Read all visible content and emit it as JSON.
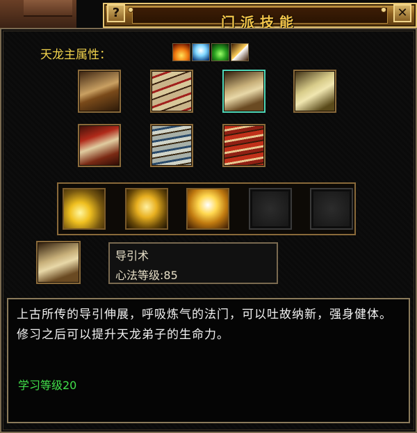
{
  "window": {
    "title": "门派技能",
    "help_label": "?",
    "close_label": "✕"
  },
  "attributes": {
    "label": "天龙主属性：",
    "icons": [
      "fire-attribute-icon",
      "ice-attribute-icon",
      "poison-attribute-icon",
      "lightning-attribute-icon"
    ]
  },
  "skill_books": [
    {
      "name": "scroll-book-icon",
      "selected": false
    },
    {
      "name": "bundled-scrolls-icon",
      "selected": false
    },
    {
      "name": "open-book-icon",
      "selected": true
    },
    {
      "name": "ancient-tome-icon",
      "selected": false
    },
    {
      "name": "figure-manual-icon",
      "selected": false
    },
    {
      "name": "blue-book-stack-icon",
      "selected": false
    },
    {
      "name": "red-book-stack-icon",
      "selected": false
    }
  ],
  "skills": [
    {
      "name": "scroll-glow-skill-icon",
      "empty": false
    },
    {
      "name": "golden-figure-skill-icon",
      "empty": false
    },
    {
      "name": "radiant-hands-skill-icon",
      "empty": false
    },
    {
      "name": "empty-skill-slot",
      "empty": true
    },
    {
      "name": "empty-skill-slot",
      "empty": true
    }
  ],
  "selected_skill": {
    "name": "导引术",
    "level": "心法等级:85"
  },
  "description": {
    "text": "上古所传的导引伸展，呼吸炼气的法门，可以吐故纳新，强身健体。修习之后可以提升天龙弟子的生命力。",
    "learn_level": "学习等级20"
  },
  "colors": {
    "title": "#f3c54a",
    "label": "#f2d34c",
    "learn_level": "#41e04a",
    "selected_border": "#4fd8b8"
  }
}
